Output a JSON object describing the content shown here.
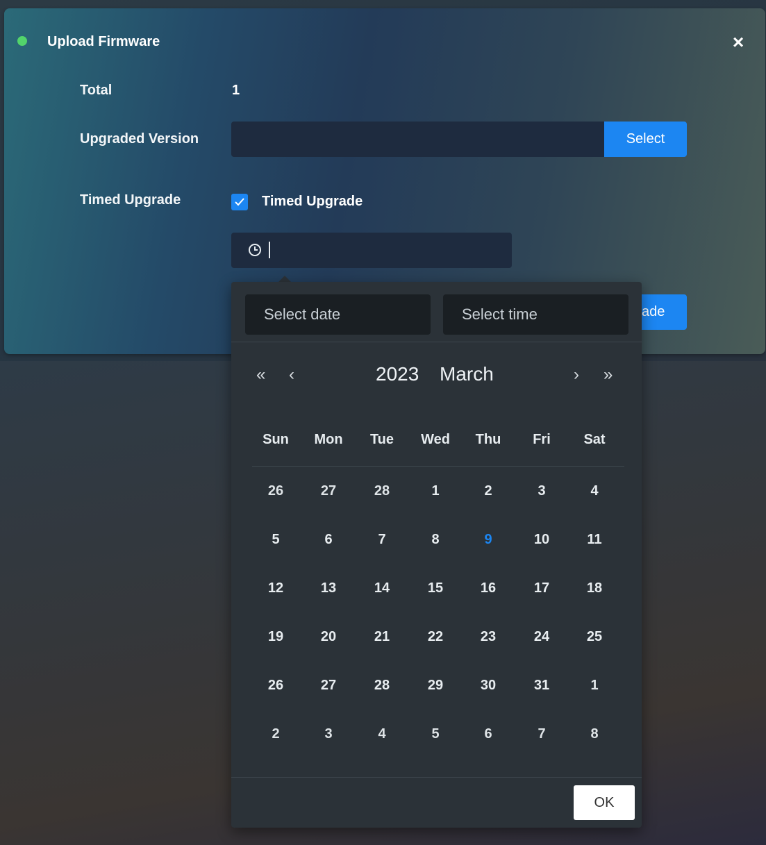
{
  "dialog": {
    "title": "Upload Firmware",
    "close_icon": "×",
    "status_color": "#52d46b"
  },
  "form": {
    "total_label": "Total",
    "total_value": "1",
    "version_label": "Upgraded Version",
    "version_value": "",
    "select_button": "Select",
    "timed_label": "Timed Upgrade",
    "timed_checkbox_label": "Timed Upgrade",
    "timed_checked": true,
    "time_value": "",
    "upgrade_button_partial": "ade"
  },
  "picker": {
    "date_placeholder": "Select date",
    "time_placeholder": "Select time",
    "nav_prev_year": "«",
    "nav_prev_month": "‹",
    "nav_next_month": "›",
    "nav_next_year": "»",
    "year": "2023",
    "month": "March",
    "weekdays": [
      "Sun",
      "Mon",
      "Tue",
      "Wed",
      "Thu",
      "Fri",
      "Sat"
    ],
    "weeks": [
      [
        "26",
        "27",
        "28",
        "1",
        "2",
        "3",
        "4"
      ],
      [
        "5",
        "6",
        "7",
        "8",
        "9",
        "10",
        "11"
      ],
      [
        "12",
        "13",
        "14",
        "15",
        "16",
        "17",
        "18"
      ],
      [
        "19",
        "20",
        "21",
        "22",
        "23",
        "24",
        "25"
      ],
      [
        "26",
        "27",
        "28",
        "29",
        "30",
        "31",
        "1"
      ],
      [
        "2",
        "3",
        "4",
        "5",
        "6",
        "7",
        "8"
      ]
    ],
    "today": "9",
    "ok_button": "OK",
    "accent_color": "#1c86f2"
  }
}
